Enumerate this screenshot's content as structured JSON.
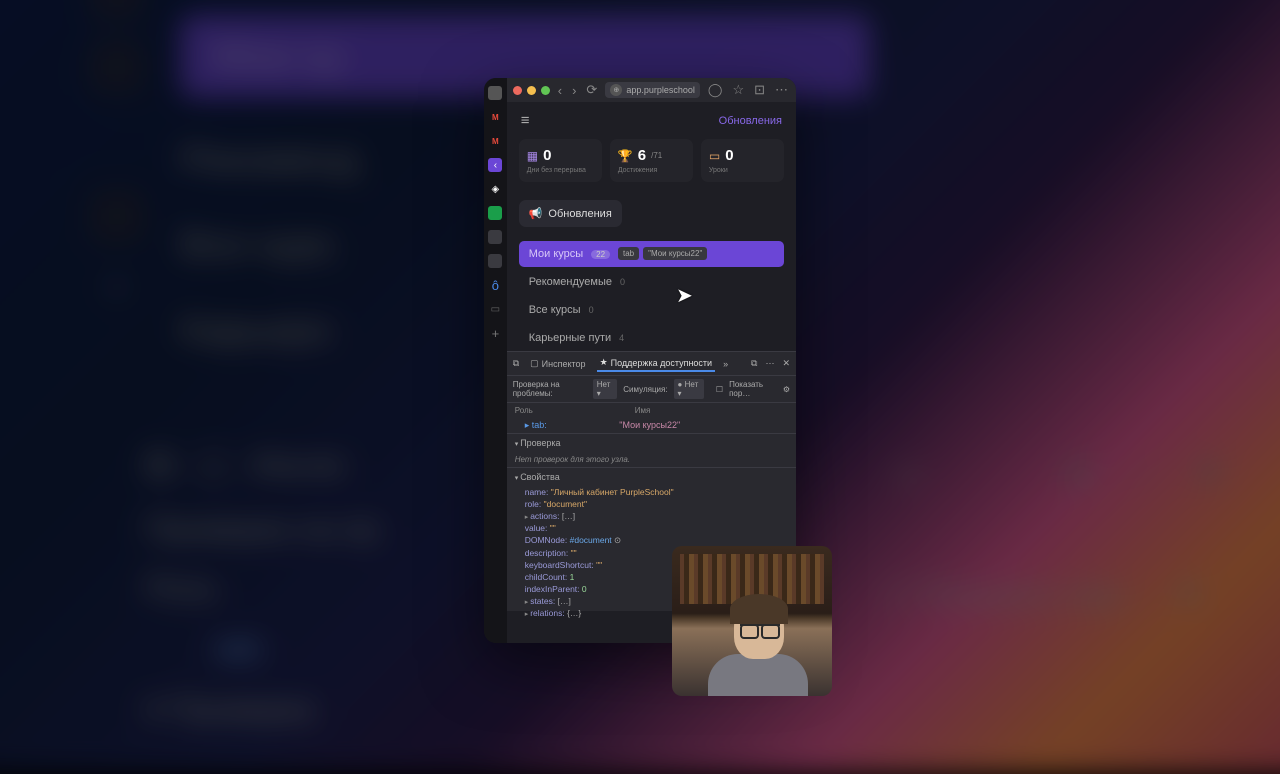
{
  "titlebar": {
    "url": "app.purpleschool"
  },
  "header": {
    "updates_link": "Обновления"
  },
  "stats": [
    {
      "value": "0",
      "label": "Дни без перерыва"
    },
    {
      "value": "6",
      "suffix": "/71",
      "label": "Достижения"
    },
    {
      "value": "0",
      "label": "Уроки"
    }
  ],
  "updates_button": "Обновления",
  "tooltip": {
    "role": "tab",
    "name": "\"Мои курсы22\""
  },
  "tabs": [
    {
      "label": "Мои курсы",
      "badge": "22",
      "active": true
    },
    {
      "label": "Рекомендуемые",
      "count": "0"
    },
    {
      "label": "Все курсы",
      "count": "0"
    },
    {
      "label": "Карьерные пути",
      "count": "4"
    }
  ],
  "devtools": {
    "tabs": {
      "inspector": "Инспектор",
      "accessibility": "Поддержка доступности"
    },
    "filters": {
      "issues_label": "Проверка на проблемы:",
      "issues_value": "Нет",
      "sim_label": "Симуляция:",
      "sim_value": "Нет",
      "show_order": "Показать пор…"
    },
    "cols": {
      "role": "Роль",
      "name": "Имя"
    },
    "tree": {
      "role": "tab:",
      "name": "\"Мои курсы22\""
    },
    "check_section": "Проверка",
    "check_msg": "Нет проверок для этого узла.",
    "props_section": "Свойства",
    "props": {
      "name_k": "name:",
      "name_v": "\"Личный кабинет PurpleSchool\"",
      "role_k": "role:",
      "role_v": "\"document\"",
      "actions_k": "actions:",
      "actions_v": "[…]",
      "value_k": "value:",
      "value_v": "\"\"",
      "dom_k": "DOMNode:",
      "dom_v": "#document",
      "desc_k": "description:",
      "desc_v": "\"\"",
      "kbd_k": "keyboardShortcut:",
      "kbd_v": "\"\"",
      "child_k": "childCount:",
      "child_v": "1",
      "idx_k": "indexInParent:",
      "idx_v": "0",
      "states_k": "states:",
      "states_v": "[…]",
      "rel_k": "relations:",
      "rel_v": "{…}"
    }
  },
  "bg": {
    "tab_active": "Мои ку",
    "reco": "Рекоменд",
    "all": "Все курс",
    "career": "Карьерн",
    "inspector": "Инспе",
    "issues": "Проверка на пр",
    "role": "Роль",
    "tabrow": "tab:",
    "check": "Проверка",
    "check_caret": "▾ ",
    "show": "Показать пор…",
    "gear": "⚙",
    "box": "☐"
  }
}
